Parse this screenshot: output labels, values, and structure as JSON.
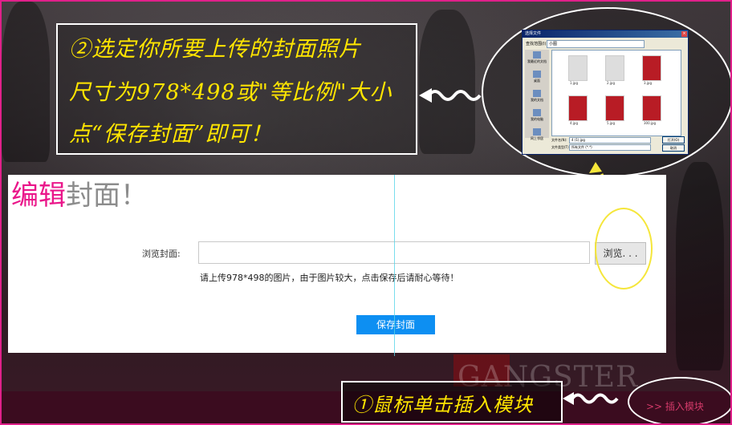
{
  "note": {
    "lines": [
      "②选定你所要上传的封面照片",
      "尺寸为978*498或\"等比例\"大小",
      "点“保存封面”即可！"
    ]
  },
  "dialog": {
    "title": "选择文件",
    "look_in_label": "查找范围(I):",
    "look_in_value": "小图",
    "sidebar": [
      "我最近的文档",
      "桌面",
      "我的文档",
      "我的电脑",
      "网上邻居"
    ],
    "files": [
      "1.jpg",
      "2.jpg",
      "3.jpg",
      "4.jpg",
      "5.jpg",
      "300.jpg"
    ],
    "filename_label": "文件名(N):",
    "filename_value": "4 (1).jpg",
    "filetype_label": "文件类型(T):",
    "filetype_value": "所有文件 (*.*)",
    "open_label": "打开(O)",
    "cancel_label": "取消"
  },
  "editor": {
    "title_accent": "编辑",
    "title_rest": "封面！",
    "browse_label": "浏览封面:",
    "browse_button": "浏览. . .",
    "file_value": "",
    "hint": "请上传978*498的图片，由于图片较大，点击保存后请耐心等待！",
    "save_button": "保存封面"
  },
  "background": {
    "watermark": "GANGSTER"
  },
  "step": {
    "text": "①鼠标单击插入模块"
  },
  "insert_module": {
    "label": ">> 插入模块"
  },
  "colors": {
    "accent": "#ea168a",
    "annotation": "#ffe500",
    "save_button": "#0d8ff2",
    "frame": "#e0208a"
  }
}
